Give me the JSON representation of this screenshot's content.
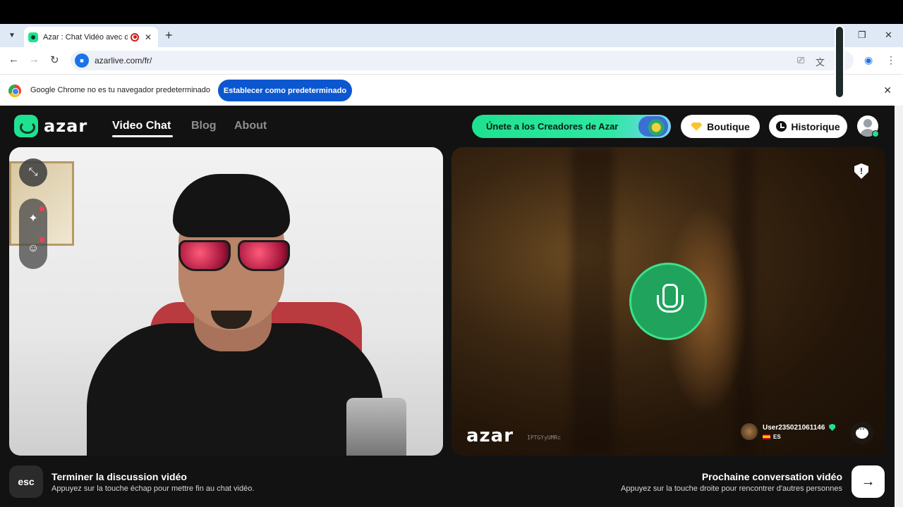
{
  "browser": {
    "tab_title": "Azar : Chat Vidéo avec de n",
    "url": "azarlive.com/fr/",
    "infobar_text": "Google Chrome no es tu navegador predeterminado",
    "set_default_label": "Establecer como predeterminado"
  },
  "header": {
    "logo_text": "azar",
    "nav": [
      {
        "label": "Video Chat"
      },
      {
        "label": "Blog"
      },
      {
        "label": "About"
      }
    ],
    "creators_label": "Únete a los Creadores de Azar",
    "boutique_label": "Boutique",
    "historique_label": "Historique"
  },
  "remote": {
    "watermark": "azar",
    "code": "IPTGYyUMRc",
    "username": "User235021061146",
    "country": "ES"
  },
  "footer": {
    "esc_key": "esc",
    "end_title": "Terminer la discussion vidéo",
    "end_sub": "Appuyez sur la touche échap pour mettre fin au chat vidéo.",
    "next_title": "Prochaine conversation vidéo",
    "next_sub": "Appuyez sur la touche droite pour rencontrer d'autres personnes"
  },
  "icons": {
    "tab_favicon": "azar-favicon-icon",
    "recording": "recording-icon",
    "minimize_video": "collapse-icon",
    "effects": "sparkle-icon",
    "stickers": "smiley-icon",
    "report": "shield-icon",
    "mic": "microphone-icon",
    "chat": "chat-bubble-icon",
    "next": "arrow-right-icon"
  },
  "colors": {
    "brand_green": "#1ee28f",
    "mic_green": "#20a35d",
    "chrome_blue": "#0b57d0",
    "page_bg": "#121212"
  }
}
